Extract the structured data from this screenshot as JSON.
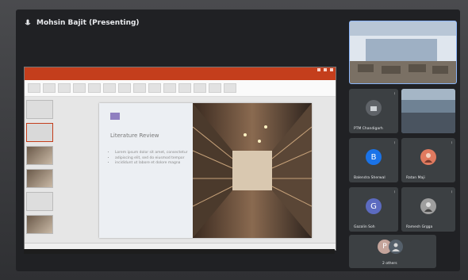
{
  "presenter": {
    "label": "Mohsin Bajit (Presenting)"
  },
  "presentation": {
    "slide_title": "Literature Review",
    "bullets": [
      "Lorem ipsum dolor sit amet, consectetur",
      "adipiscing elit, sed do eiusmod tempor",
      "incididunt ut labore et dolore magna"
    ]
  },
  "participants": [
    {
      "name": "PTM Chandigarh",
      "initial": "",
      "color": "#5f6368"
    },
    {
      "name": "",
      "initial": "",
      "color": "#3c4043"
    },
    {
      "name": "Balendra Sherwal",
      "initial": "B",
      "color": "#1a73e8"
    },
    {
      "name": "Ratan Maji",
      "initial": "",
      "color": "#e07a5f"
    },
    {
      "name": "Gazalin Soh",
      "initial": "G",
      "color": "#5c6bc0"
    },
    {
      "name": "Ramesh Grgga",
      "initial": "",
      "color": "#9e9e9e"
    },
    {
      "name": "2 others",
      "initial": "P",
      "color": "#c4a49b"
    }
  ],
  "colors": {
    "accent": "#8ab4f8",
    "ppt": "#c43e1c",
    "tile": "#3c4043"
  }
}
